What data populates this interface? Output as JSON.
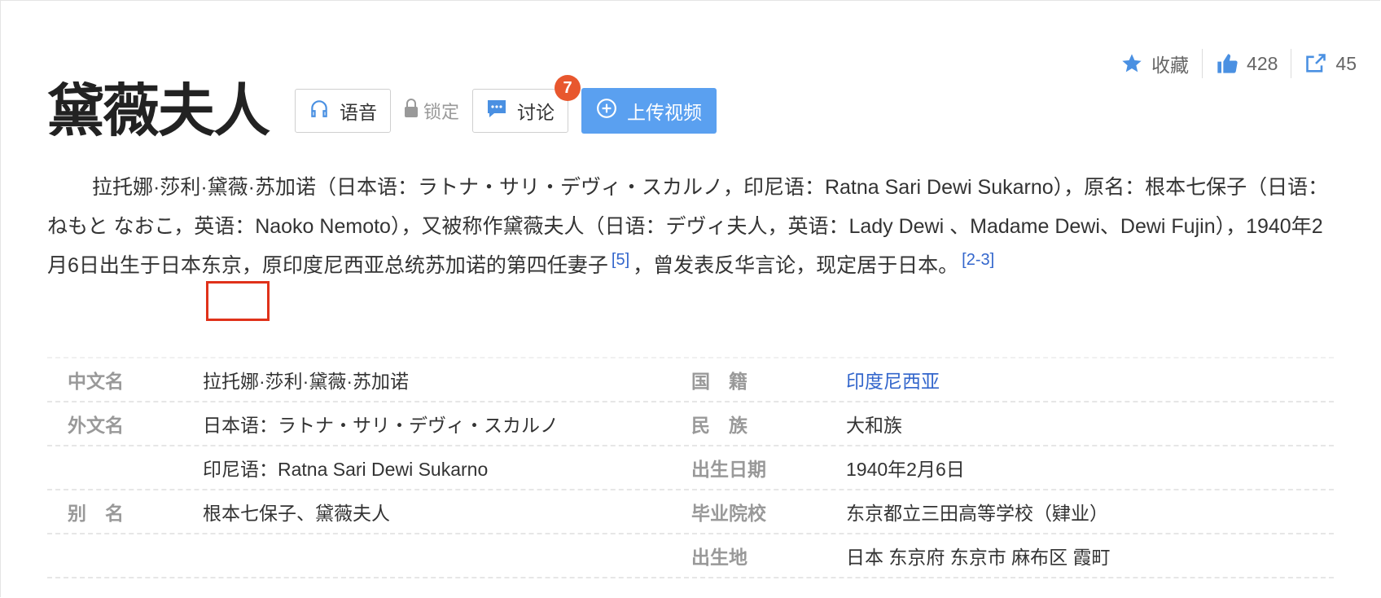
{
  "actions": {
    "collect_label": "收藏",
    "like_count": "428",
    "share_count": "45"
  },
  "title": "黛薇夫人",
  "toolbar": {
    "voice_label": "语音",
    "lock_label": "锁定",
    "discuss_label": "讨论",
    "discuss_badge": "7",
    "upload_label": "上传视频"
  },
  "summary": {
    "part1": "拉托娜·莎利·黛薇·苏加诺（日本语：ラトナ・サリ・デヴィ・スカルノ，印尼语：Ratna Sari Dewi Sukarno），原名：根本七保子（日语：ねもと なおこ，英语：Naoko Nemoto），又被称作黛薇夫人（日语：デヴィ夫人，英语：Lady Dewi 、Madame Dewi、Dewi Fujin），1940年2月6日出生于日本东京，原印度尼西亚总统苏加诺的第四任妻子",
    "ref1": "[5]",
    "part2": "，曾发表反华言论，现定居于日本。",
    "ref2": "[2-3]"
  },
  "info": {
    "rows": [
      {
        "name": "中文名",
        "value": "拉托娜·莎利·黛薇·苏加诺",
        "name2": "国　籍",
        "value2": "印度尼西亚"
      },
      {
        "name": "外文名",
        "value": "日本语：ラトナ・サリ・デヴィ・スカルノ",
        "name2": "民　族",
        "value2": "大和族"
      },
      {
        "name": "",
        "value": "印尼语：Ratna Sari Dewi Sukarno",
        "name2": "出生日期",
        "value2": "1940年2月6日"
      },
      {
        "name": "别　名",
        "value": "根本七保子、黛薇夫人",
        "name2": "毕业院校",
        "value2": "东京都立三田高等学校（肄业）"
      },
      {
        "name": "",
        "value": "",
        "name2": "出生地",
        "value2": "日本 东京府 东京市 麻布区 霞町"
      }
    ]
  },
  "colors": {
    "accent": "#3366cc",
    "upload_bg": "#5aa0f0",
    "badge": "#e8572e",
    "highlight_box": "#e0321a"
  },
  "icons": {
    "collect": "star-icon",
    "like": "thumbs-up-icon",
    "share": "share-icon",
    "voice": "headphones-icon",
    "lock": "lock-icon",
    "discuss": "chat-bubble-icon",
    "upload": "plus-circle-icon"
  }
}
